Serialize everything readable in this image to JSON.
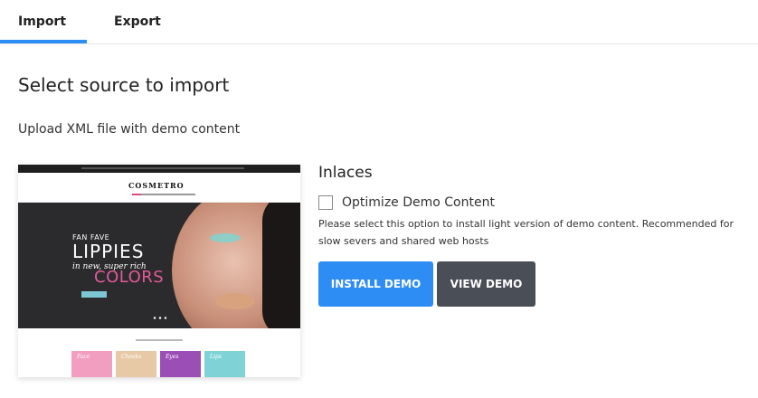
{
  "tabs": {
    "import_label": "Import",
    "export_label": "Export",
    "active": "Import"
  },
  "page": {
    "title": "Select source to import",
    "subtitle": "Upload XML file with demo content"
  },
  "preview": {
    "logo_text": "COSMETRO",
    "hero_line1": "FAN FAVE",
    "hero_line2": "LIPPIES",
    "hero_line3": "in new, super rich",
    "hero_line4": "COLORS",
    "categories": [
      "Face",
      "Cheeks",
      "Eyes",
      "Lips"
    ],
    "category_colors": [
      "#f29ec0",
      "#e8c9a6",
      "#9b4fb6",
      "#7fd3d6"
    ]
  },
  "demo": {
    "name": "Inlaces",
    "option_label": "Optimize Demo Content",
    "option_checked": false,
    "help_text": "Please select this option to install light version of demo content. Recommended for slow severs and shared web hosts",
    "install_button": "INSTALL DEMO",
    "view_button": "VIEW DEMO"
  },
  "colors": {
    "accent": "#2e8df4",
    "secondary_button": "#4a4f57"
  }
}
